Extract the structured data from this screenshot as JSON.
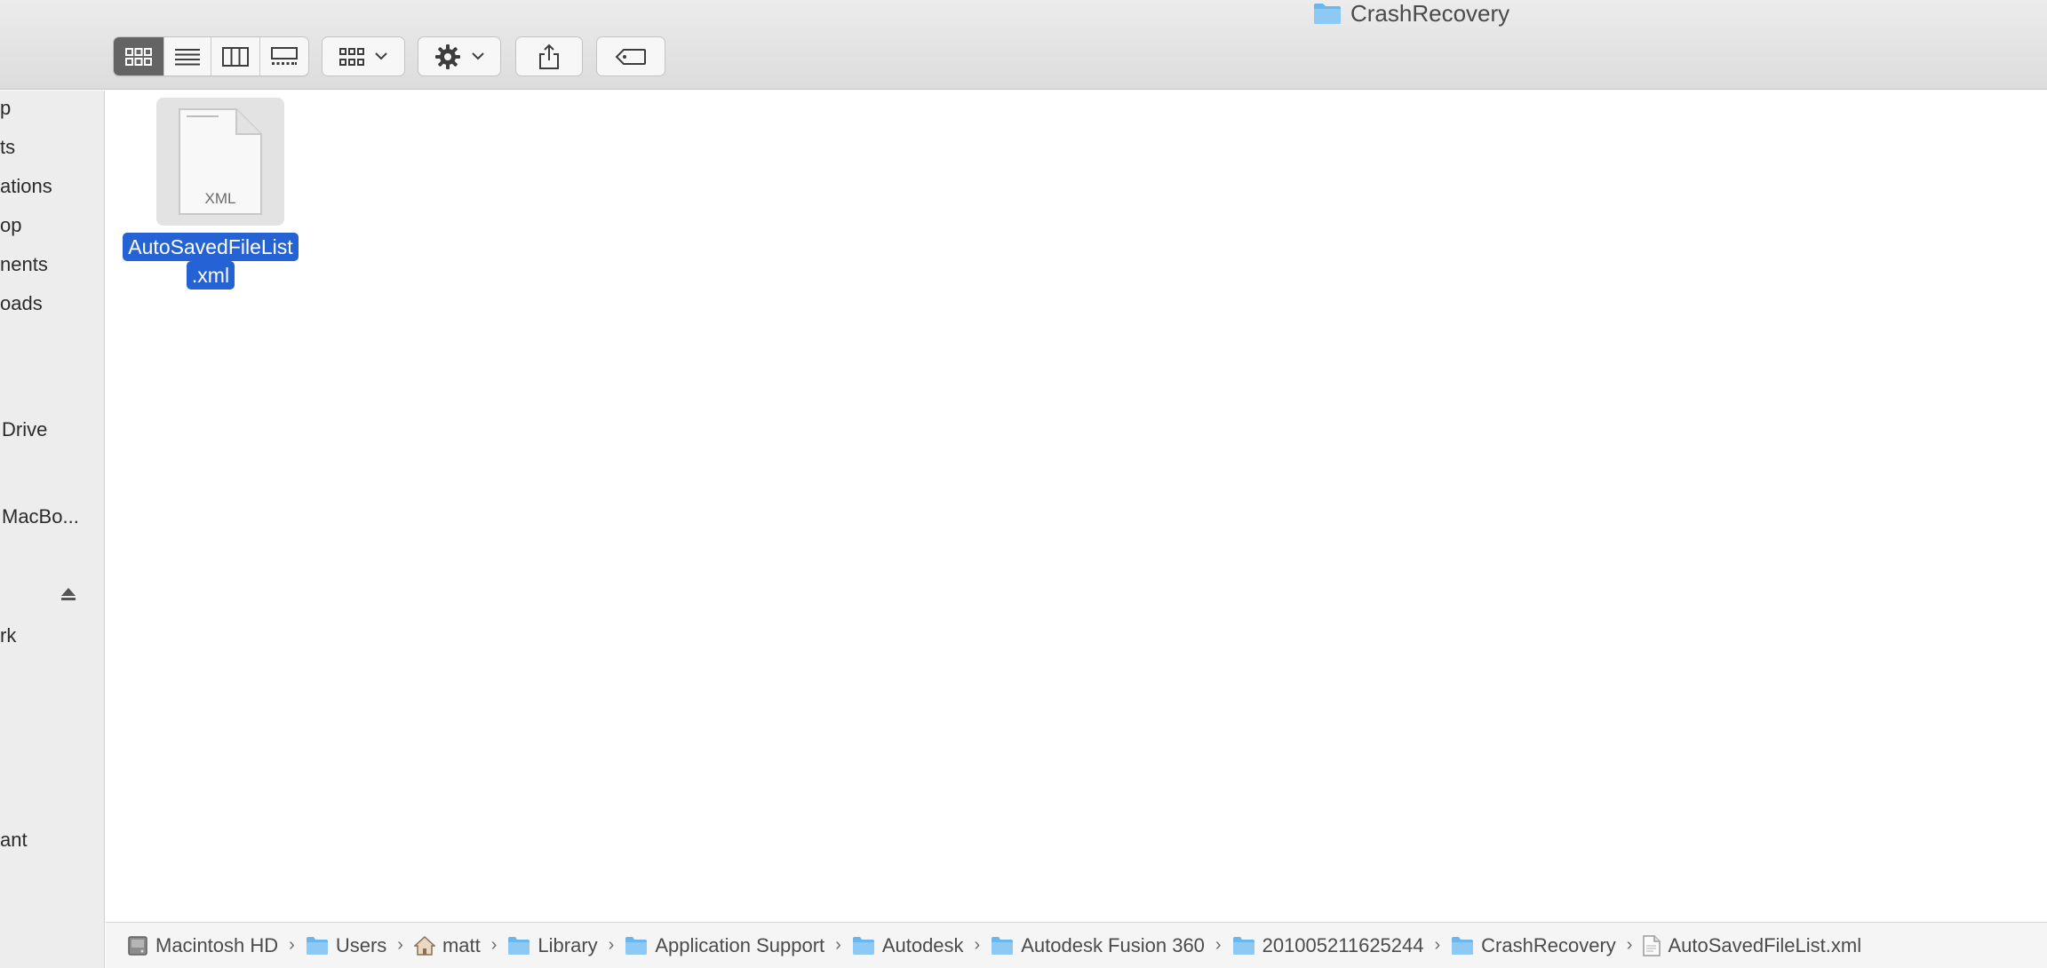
{
  "window": {
    "title": "CrashRecovery"
  },
  "toolbar": {
    "view_modes": [
      "icon-view",
      "list-view",
      "column-view",
      "gallery-view"
    ],
    "active_view": "icon-view",
    "group_button": "group-by-menu",
    "action_button": "action-menu",
    "share_button": "share",
    "tag_button": "edit-tags"
  },
  "sidebar": {
    "items": [
      {
        "label": "p"
      },
      {
        "label": "ts"
      },
      {
        "label": "ations"
      },
      {
        "label": "op"
      },
      {
        "label": "nents"
      },
      {
        "label": "oads"
      },
      {
        "label": "Drive"
      },
      {
        "label": "MacBo..."
      },
      {
        "label": "rk"
      },
      {
        "label": "ant"
      }
    ]
  },
  "content": {
    "files": [
      {
        "name_line1": "AutoSavedFileList",
        "name_line2": ".xml",
        "type_label": "XML",
        "selected": true
      }
    ]
  },
  "pathbar": {
    "crumbs": [
      {
        "label": "Macintosh HD",
        "icon": "hard-drive-icon"
      },
      {
        "label": "Users",
        "icon": "folder-icon"
      },
      {
        "label": "matt",
        "icon": "home-icon"
      },
      {
        "label": "Library",
        "icon": "folder-icon"
      },
      {
        "label": "Application Support",
        "icon": "folder-icon"
      },
      {
        "label": "Autodesk",
        "icon": "folder-icon"
      },
      {
        "label": "Autodesk Fusion 360",
        "icon": "folder-icon"
      },
      {
        "label": "201005211625244",
        "icon": "folder-icon"
      },
      {
        "label": "CrashRecovery",
        "icon": "folder-icon"
      },
      {
        "label": "AutoSavedFileList.xml",
        "icon": "document-icon"
      }
    ]
  },
  "colors": {
    "selection": "#2563d4",
    "folder": "#6cb6ee",
    "active_segment": "#646464"
  }
}
